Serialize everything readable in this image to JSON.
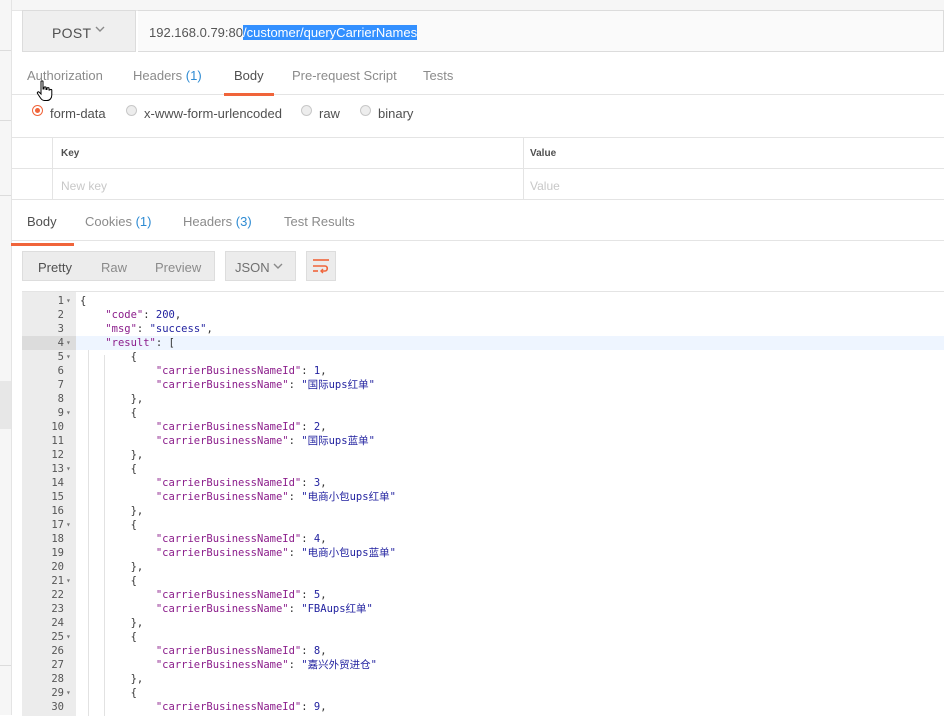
{
  "request": {
    "method": "POST",
    "url_base": "192.168.0.79:80",
    "url_path": "/customer/queryCarrierNames"
  },
  "request_tabs": [
    {
      "label": "Authorization",
      "count": ""
    },
    {
      "label": "Headers",
      "count": "(1)"
    },
    {
      "label": "Body",
      "count": "",
      "active": true
    },
    {
      "label": "Pre-request Script",
      "count": ""
    },
    {
      "label": "Tests",
      "count": ""
    }
  ],
  "body_types": [
    {
      "label": "form-data",
      "selected": true
    },
    {
      "label": "x-www-form-urlencoded",
      "selected": false
    },
    {
      "label": "raw",
      "selected": false
    },
    {
      "label": "binary",
      "selected": false
    }
  ],
  "kv_table": {
    "key_header": "Key",
    "value_header": "Value",
    "key_placeholder": "New key",
    "value_placeholder": "Value"
  },
  "response_tabs": [
    {
      "label": "Body",
      "count": "",
      "active": true
    },
    {
      "label": "Cookies",
      "count": "(1)"
    },
    {
      "label": "Headers",
      "count": "(3)"
    },
    {
      "label": "Test Results",
      "count": ""
    }
  ],
  "view_modes": [
    "Pretty",
    "Raw",
    "Preview"
  ],
  "active_view": "Pretty",
  "format": "JSON",
  "icons": {
    "method_dropdown": "chevron-down-icon",
    "format_dropdown": "chevron-down-icon",
    "wrap": "wrap-lines-icon",
    "cursor": "hand-pointer-icon"
  },
  "colors": {
    "accent": "#f0643a",
    "count": "#2e8bd3",
    "selection": "#3390ff"
  },
  "code_lines": [
    {
      "n": "1",
      "fold": true,
      "indent": 0,
      "segs": [
        {
          "t": "p",
          "v": "{"
        }
      ]
    },
    {
      "n": "2",
      "fold": false,
      "indent": 1,
      "segs": [
        {
          "t": "k",
          "v": "\"code\""
        },
        {
          "t": "p",
          "v": ": "
        },
        {
          "t": "n",
          "v": "200"
        },
        {
          "t": "p",
          "v": ","
        }
      ]
    },
    {
      "n": "3",
      "fold": false,
      "indent": 1,
      "segs": [
        {
          "t": "k",
          "v": "\"msg\""
        },
        {
          "t": "p",
          "v": ": "
        },
        {
          "t": "s",
          "v": "\"success\""
        },
        {
          "t": "p",
          "v": ","
        }
      ]
    },
    {
      "n": "4",
      "fold": true,
      "indent": 1,
      "cur": true,
      "segs": [
        {
          "t": "k",
          "v": "\"result\""
        },
        {
          "t": "p",
          "v": ": ["
        }
      ]
    },
    {
      "n": "5",
      "fold": true,
      "indent": 2,
      "segs": [
        {
          "t": "p",
          "v": "{"
        }
      ]
    },
    {
      "n": "6",
      "fold": false,
      "indent": 3,
      "segs": [
        {
          "t": "k",
          "v": "\"carrierBusinessNameId\""
        },
        {
          "t": "p",
          "v": ": "
        },
        {
          "t": "n",
          "v": "1"
        },
        {
          "t": "p",
          "v": ","
        }
      ]
    },
    {
      "n": "7",
      "fold": false,
      "indent": 3,
      "segs": [
        {
          "t": "k",
          "v": "\"carrierBusinessName\""
        },
        {
          "t": "p",
          "v": ": "
        },
        {
          "t": "s",
          "v": "\"国际ups红单\""
        }
      ]
    },
    {
      "n": "8",
      "fold": false,
      "indent": 2,
      "segs": [
        {
          "t": "p",
          "v": "},"
        }
      ]
    },
    {
      "n": "9",
      "fold": true,
      "indent": 2,
      "segs": [
        {
          "t": "p",
          "v": "{"
        }
      ]
    },
    {
      "n": "10",
      "fold": false,
      "indent": 3,
      "segs": [
        {
          "t": "k",
          "v": "\"carrierBusinessNameId\""
        },
        {
          "t": "p",
          "v": ": "
        },
        {
          "t": "n",
          "v": "2"
        },
        {
          "t": "p",
          "v": ","
        }
      ]
    },
    {
      "n": "11",
      "fold": false,
      "indent": 3,
      "segs": [
        {
          "t": "k",
          "v": "\"carrierBusinessName\""
        },
        {
          "t": "p",
          "v": ": "
        },
        {
          "t": "s",
          "v": "\"国际ups蓝单\""
        }
      ]
    },
    {
      "n": "12",
      "fold": false,
      "indent": 2,
      "segs": [
        {
          "t": "p",
          "v": "},"
        }
      ]
    },
    {
      "n": "13",
      "fold": true,
      "indent": 2,
      "segs": [
        {
          "t": "p",
          "v": "{"
        }
      ]
    },
    {
      "n": "14",
      "fold": false,
      "indent": 3,
      "segs": [
        {
          "t": "k",
          "v": "\"carrierBusinessNameId\""
        },
        {
          "t": "p",
          "v": ": "
        },
        {
          "t": "n",
          "v": "3"
        },
        {
          "t": "p",
          "v": ","
        }
      ]
    },
    {
      "n": "15",
      "fold": false,
      "indent": 3,
      "segs": [
        {
          "t": "k",
          "v": "\"carrierBusinessName\""
        },
        {
          "t": "p",
          "v": ": "
        },
        {
          "t": "s",
          "v": "\"电商小包ups红单\""
        }
      ]
    },
    {
      "n": "16",
      "fold": false,
      "indent": 2,
      "segs": [
        {
          "t": "p",
          "v": "},"
        }
      ]
    },
    {
      "n": "17",
      "fold": true,
      "indent": 2,
      "segs": [
        {
          "t": "p",
          "v": "{"
        }
      ]
    },
    {
      "n": "18",
      "fold": false,
      "indent": 3,
      "segs": [
        {
          "t": "k",
          "v": "\"carrierBusinessNameId\""
        },
        {
          "t": "p",
          "v": ": "
        },
        {
          "t": "n",
          "v": "4"
        },
        {
          "t": "p",
          "v": ","
        }
      ]
    },
    {
      "n": "19",
      "fold": false,
      "indent": 3,
      "segs": [
        {
          "t": "k",
          "v": "\"carrierBusinessName\""
        },
        {
          "t": "p",
          "v": ": "
        },
        {
          "t": "s",
          "v": "\"电商小包ups蓝单\""
        }
      ]
    },
    {
      "n": "20",
      "fold": false,
      "indent": 2,
      "segs": [
        {
          "t": "p",
          "v": "},"
        }
      ]
    },
    {
      "n": "21",
      "fold": true,
      "indent": 2,
      "segs": [
        {
          "t": "p",
          "v": "{"
        }
      ]
    },
    {
      "n": "22",
      "fold": false,
      "indent": 3,
      "segs": [
        {
          "t": "k",
          "v": "\"carrierBusinessNameId\""
        },
        {
          "t": "p",
          "v": ": "
        },
        {
          "t": "n",
          "v": "5"
        },
        {
          "t": "p",
          "v": ","
        }
      ]
    },
    {
      "n": "23",
      "fold": false,
      "indent": 3,
      "segs": [
        {
          "t": "k",
          "v": "\"carrierBusinessName\""
        },
        {
          "t": "p",
          "v": ": "
        },
        {
          "t": "s",
          "v": "\"FBAups红单\""
        }
      ]
    },
    {
      "n": "24",
      "fold": false,
      "indent": 2,
      "segs": [
        {
          "t": "p",
          "v": "},"
        }
      ]
    },
    {
      "n": "25",
      "fold": true,
      "indent": 2,
      "segs": [
        {
          "t": "p",
          "v": "{"
        }
      ]
    },
    {
      "n": "26",
      "fold": false,
      "indent": 3,
      "segs": [
        {
          "t": "k",
          "v": "\"carrierBusinessNameId\""
        },
        {
          "t": "p",
          "v": ": "
        },
        {
          "t": "n",
          "v": "8"
        },
        {
          "t": "p",
          "v": ","
        }
      ]
    },
    {
      "n": "27",
      "fold": false,
      "indent": 3,
      "segs": [
        {
          "t": "k",
          "v": "\"carrierBusinessName\""
        },
        {
          "t": "p",
          "v": ": "
        },
        {
          "t": "s",
          "v": "\"嘉兴外贸进仓\""
        }
      ]
    },
    {
      "n": "28",
      "fold": false,
      "indent": 2,
      "segs": [
        {
          "t": "p",
          "v": "},"
        }
      ]
    },
    {
      "n": "29",
      "fold": true,
      "indent": 2,
      "segs": [
        {
          "t": "p",
          "v": "{"
        }
      ]
    },
    {
      "n": "30",
      "fold": false,
      "indent": 3,
      "segs": [
        {
          "t": "k",
          "v": "\"carrierBusinessNameId\""
        },
        {
          "t": "p",
          "v": ": "
        },
        {
          "t": "n",
          "v": "9"
        },
        {
          "t": "p",
          "v": ","
        }
      ]
    }
  ]
}
